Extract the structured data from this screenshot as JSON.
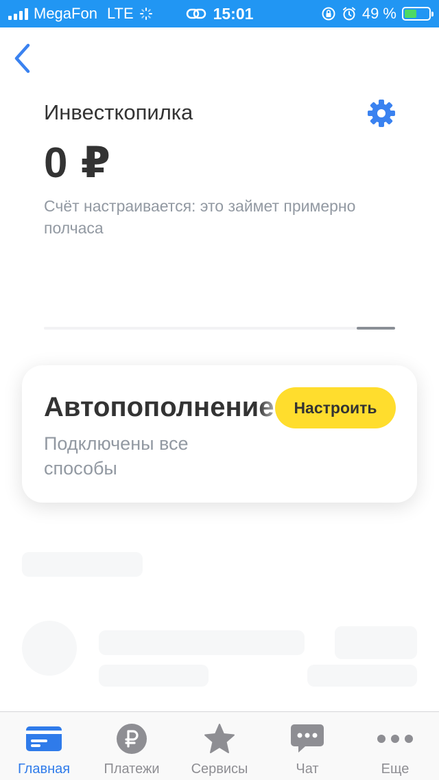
{
  "status_bar": {
    "carrier": "MegaFon",
    "network": "LTE",
    "time": "15:01",
    "battery_text": "49 %",
    "battery_level": 0.49
  },
  "header": {
    "title": "Инвесткопилка",
    "amount": "0 ₽",
    "subtitle": "Счёт настраивается: это займет примерно полчаса"
  },
  "autofill_card": {
    "title": "Автопополнение",
    "description": "Подключены все способы",
    "button_label": "Настроить"
  },
  "tab_bar": {
    "tabs": [
      {
        "label": "Главная",
        "icon": "card-icon",
        "active": true
      },
      {
        "label": "Платежи",
        "icon": "ruble-icon",
        "active": false
      },
      {
        "label": "Сервисы",
        "icon": "star-icon",
        "active": false
      },
      {
        "label": "Чат",
        "icon": "chat-icon",
        "active": false
      },
      {
        "label": "Еще",
        "icon": "more-icon",
        "active": false
      }
    ]
  },
  "colors": {
    "status_bar_bg": "#2196f3",
    "accent_blue": "#2f7bea",
    "button_yellow": "#ffdd2d",
    "muted_text": "#9299a2"
  }
}
